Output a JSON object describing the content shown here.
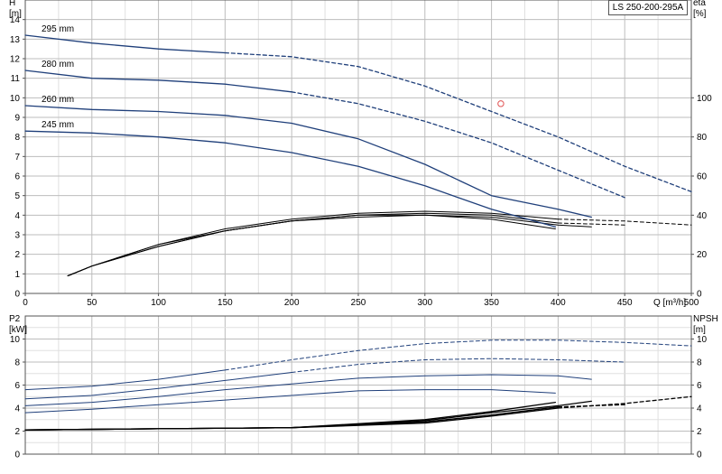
{
  "product_label": "LS 250-200-295A",
  "colors": {
    "head": "#1f3f7a",
    "power": "#1f3f7a",
    "eff": "#000000",
    "npsh": "#000000",
    "grid": "#c8c8c8",
    "marker": "#e05050"
  },
  "chart_data": [
    {
      "type": "line",
      "name": "head-efficiency",
      "xlabel": "Q [m³/h]",
      "xlim": [
        0,
        500
      ],
      "xticks": [
        0,
        50,
        100,
        150,
        200,
        250,
        300,
        350,
        400,
        450,
        500
      ],
      "grid": true,
      "left_axis": {
        "label": [
          "H",
          "[m]"
        ],
        "lim": [
          0,
          15
        ],
        "ticks": [
          0,
          1,
          2,
          3,
          4,
          5,
          6,
          7,
          8,
          9,
          10,
          11,
          12,
          13,
          14
        ]
      },
      "right_axis": {
        "label": [
          "eta",
          "[%]"
        ],
        "lim": [
          0,
          150
        ],
        "ticks": [
          0,
          20,
          40,
          60,
          80,
          100
        ]
      },
      "head_curves": [
        {
          "name": "295 mm",
          "solid": [
            [
              0,
              13.2
            ],
            [
              50,
              12.8
            ],
            [
              100,
              12.5
            ],
            [
              150,
              12.3
            ]
          ],
          "dashed": [
            [
              150,
              12.3
            ],
            [
              200,
              12.1
            ],
            [
              250,
              11.6
            ],
            [
              300,
              10.6
            ],
            [
              350,
              9.3
            ],
            [
              400,
              8.0
            ],
            [
              450,
              6.5
            ],
            [
              500,
              5.2
            ]
          ]
        },
        {
          "name": "280 mm",
          "solid": [
            [
              0,
              11.4
            ],
            [
              50,
              11.0
            ],
            [
              100,
              10.9
            ],
            [
              150,
              10.7
            ],
            [
              200,
              10.3
            ]
          ],
          "dashed": [
            [
              200,
              10.3
            ],
            [
              250,
              9.7
            ],
            [
              300,
              8.8
            ],
            [
              350,
              7.7
            ],
            [
              400,
              6.3
            ],
            [
              450,
              4.9
            ]
          ]
        },
        {
          "name": "260 mm",
          "solid": [
            [
              0,
              9.6
            ],
            [
              50,
              9.4
            ],
            [
              100,
              9.3
            ],
            [
              150,
              9.1
            ],
            [
              200,
              8.7
            ],
            [
              250,
              7.9
            ],
            [
              300,
              6.6
            ],
            [
              350,
              5.0
            ],
            [
              400,
              4.3
            ],
            [
              425,
              3.9
            ]
          ],
          "dashed": []
        },
        {
          "name": "245 mm",
          "solid": [
            [
              0,
              8.3
            ],
            [
              50,
              8.2
            ],
            [
              100,
              8.0
            ],
            [
              150,
              7.7
            ],
            [
              200,
              7.2
            ],
            [
              250,
              6.5
            ],
            [
              300,
              5.5
            ],
            [
              350,
              4.3
            ],
            [
              398,
              3.4
            ]
          ],
          "dashed": []
        }
      ],
      "eff_curves": [
        {
          "solid": [
            [
              32,
              9
            ],
            [
              50,
              14
            ],
            [
              100,
              25
            ],
            [
              150,
              33
            ],
            [
              200,
              38
            ],
            [
              250,
              41
            ],
            [
              300,
              42
            ],
            [
              350,
              41
            ],
            [
              400,
              38
            ]
          ],
          "dashed": [
            [
              400,
              38
            ],
            [
              450,
              37
            ],
            [
              500,
              35
            ]
          ]
        },
        {
          "solid": [
            [
              32,
              9
            ],
            [
              50,
              14
            ],
            [
              100,
              25
            ],
            [
              150,
              32
            ],
            [
              200,
              37
            ],
            [
              250,
              40
            ],
            [
              300,
              41
            ],
            [
              350,
              40
            ],
            [
              400,
              36
            ]
          ],
          "dashed": [
            [
              400,
              36
            ],
            [
              450,
              35
            ]
          ]
        },
        {
          "solid": [
            [
              32,
              9
            ],
            [
              50,
              14
            ],
            [
              100,
              24
            ],
            [
              150,
              32
            ],
            [
              200,
              37
            ],
            [
              250,
              40
            ],
            [
              300,
              40
            ],
            [
              350,
              39
            ],
            [
              400,
              35
            ],
            [
              425,
              34
            ]
          ],
          "dashed": []
        },
        {
          "solid": [
            [
              32,
              9
            ],
            [
              50,
              14
            ],
            [
              100,
              24
            ],
            [
              150,
              32
            ],
            [
              200,
              37
            ],
            [
              250,
              39
            ],
            [
              300,
              40
            ],
            [
              350,
              38
            ],
            [
              398,
              33
            ]
          ],
          "dashed": []
        }
      ],
      "duty_point": {
        "x": 357,
        "y": 9.7
      }
    },
    {
      "type": "line",
      "name": "power-npsh",
      "xlim": [
        0,
        500
      ],
      "grid": true,
      "left_axis": {
        "label": [
          "P2",
          "[kW]"
        ],
        "lim": [
          0,
          12
        ],
        "ticks": [
          0,
          2,
          4,
          6,
          8,
          10
        ]
      },
      "right_axis": {
        "label": [
          "NPSH",
          "[m]"
        ],
        "lim": [
          0,
          12
        ],
        "ticks": [
          0,
          2,
          4,
          6,
          8,
          10
        ]
      },
      "power_curves": [
        {
          "name": "295 mm",
          "solid": [
            [
              0,
              5.6
            ],
            [
              50,
              5.9
            ],
            [
              100,
              6.5
            ],
            [
              150,
              7.3
            ]
          ],
          "dashed": [
            [
              150,
              7.3
            ],
            [
              200,
              8.2
            ],
            [
              250,
              9.0
            ],
            [
              300,
              9.6
            ],
            [
              350,
              9.9
            ],
            [
              400,
              9.9
            ],
            [
              450,
              9.7
            ],
            [
              500,
              9.4
            ]
          ]
        },
        {
          "name": "280 mm",
          "solid": [
            [
              0,
              4.8
            ],
            [
              50,
              5.1
            ],
            [
              100,
              5.7
            ],
            [
              150,
              6.4
            ],
            [
              200,
              7.1
            ]
          ],
          "dashed": [
            [
              200,
              7.1
            ],
            [
              250,
              7.8
            ],
            [
              300,
              8.2
            ],
            [
              350,
              8.3
            ],
            [
              400,
              8.2
            ],
            [
              450,
              8.0
            ]
          ]
        },
        {
          "name": "260 mm",
          "solid": [
            [
              0,
              4.2
            ],
            [
              50,
              4.5
            ],
            [
              100,
              5.0
            ],
            [
              150,
              5.6
            ],
            [
              200,
              6.1
            ],
            [
              250,
              6.6
            ],
            [
              300,
              6.8
            ],
            [
              350,
              6.9
            ],
            [
              400,
              6.8
            ],
            [
              425,
              6.5
            ]
          ],
          "dashed": []
        },
        {
          "name": "245 mm",
          "solid": [
            [
              0,
              3.6
            ],
            [
              50,
              3.9
            ],
            [
              100,
              4.3
            ],
            [
              150,
              4.7
            ],
            [
              200,
              5.1
            ],
            [
              250,
              5.5
            ],
            [
              300,
              5.6
            ],
            [
              350,
              5.6
            ],
            [
              398,
              5.3
            ]
          ],
          "dashed": []
        }
      ],
      "npsh_curves": [
        {
          "solid": [
            [
              0,
              2.1
            ],
            [
              100,
              2.2
            ],
            [
              200,
              2.3
            ],
            [
              300,
              2.7
            ],
            [
              350,
              3.3
            ],
            [
              400,
              4.0
            ]
          ],
          "dashed": [
            [
              400,
              4.0
            ],
            [
              450,
              4.4
            ],
            [
              500,
              5.0
            ]
          ]
        },
        {
          "solid": [
            [
              0,
              2.1
            ],
            [
              100,
              2.2
            ],
            [
              200,
              2.3
            ],
            [
              300,
              2.8
            ],
            [
              350,
              3.4
            ],
            [
              400,
              4.1
            ]
          ],
          "dashed": [
            [
              400,
              4.1
            ],
            [
              450,
              4.3
            ]
          ]
        },
        {
          "solid": [
            [
              0,
              2.1
            ],
            [
              100,
              2.2
            ],
            [
              200,
              2.3
            ],
            [
              300,
              2.9
            ],
            [
              350,
              3.6
            ],
            [
              400,
              4.2
            ],
            [
              425,
              4.6
            ]
          ],
          "dashed": []
        },
        {
          "solid": [
            [
              0,
              2.1
            ],
            [
              100,
              2.2
            ],
            [
              200,
              2.3
            ],
            [
              300,
              3.0
            ],
            [
              350,
              3.7
            ],
            [
              398,
              4.5
            ]
          ],
          "dashed": []
        }
      ]
    }
  ]
}
